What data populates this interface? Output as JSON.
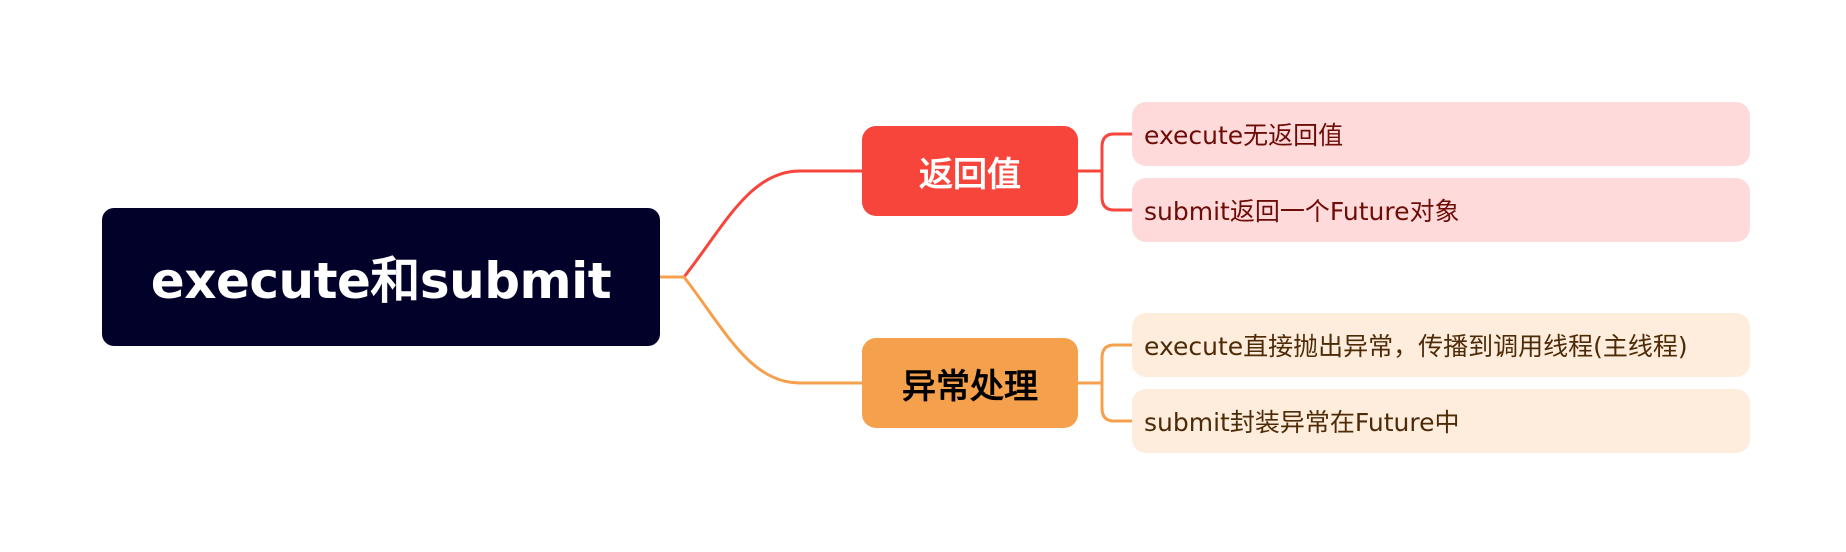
{
  "colors": {
    "root_bg": "#02012a",
    "root_text": "#ffffff",
    "branch_0": "#f8453c",
    "branch_0_text": "#ffffff",
    "leaf_0_bg": "#fedbda",
    "leaf_0_text": "#6e0c08",
    "branch_1": "#f5a04c",
    "branch_1_text": "#000000",
    "leaf_1_bg": "#feecdc",
    "leaf_1_text": "#4e2b07"
  },
  "mindmap": {
    "root": {
      "label": "execute和submit"
    },
    "branches": [
      {
        "label": "返回值",
        "children": [
          {
            "label": "execute无返回值"
          },
          {
            "label": "submit返回一个Future对象"
          }
        ]
      },
      {
        "label": "异常处理",
        "children": [
          {
            "label": "execute直接抛出异常，传播到调用线程(主线程)"
          },
          {
            "label": "submit封装异常在Future中"
          }
        ]
      }
    ]
  }
}
